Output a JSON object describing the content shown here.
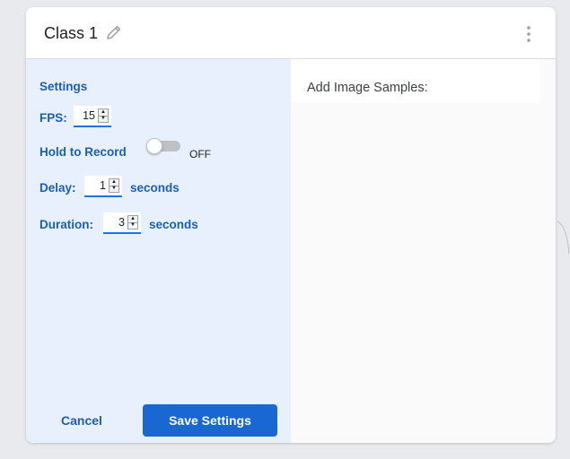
{
  "header": {
    "title": "Class 1",
    "edit_icon": "pencil-icon",
    "menu_icon": "more-vert-icon"
  },
  "settings": {
    "heading": "Settings",
    "fps": {
      "label": "FPS:",
      "value": "15"
    },
    "hold_to_record": {
      "label": "Hold to Record",
      "state": "OFF",
      "enabled": false
    },
    "delay": {
      "label": "Delay:",
      "value": "1",
      "unit": "seconds"
    },
    "duration": {
      "label": "Duration:",
      "value": "3",
      "unit": "seconds"
    },
    "cancel_label": "Cancel",
    "save_label": "Save Settings"
  },
  "samples": {
    "label": "Add Image Samples:"
  },
  "colors": {
    "accent": "#1967d2",
    "panel_bg": "#e8f0fe",
    "label_blue": "#1a5fb4"
  }
}
